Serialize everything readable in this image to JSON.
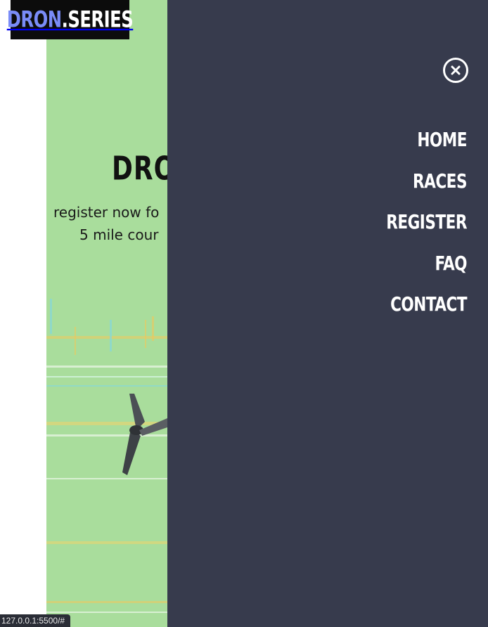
{
  "logo": {
    "part1": "DRON",
    "part2": ".SERIES"
  },
  "hero": {
    "title": "DRON",
    "subtitle_line1": "register now fo",
    "subtitle_line2": "5 mile cour"
  },
  "menu": {
    "close_icon": "close-circle-icon",
    "items": [
      {
        "label": "HOME"
      },
      {
        "label": "RACES"
      },
      {
        "label": "REGISTER"
      },
      {
        "label": "FAQ"
      },
      {
        "label": "CONTACT"
      }
    ]
  },
  "status_bar": {
    "url": "127.0.0.1:5500/#"
  },
  "colors": {
    "menu_bg": "#373b4d",
    "hero_bg": "#a9dd9c",
    "logo_accent": "#7a8cf7",
    "logo_bg": "#0c0c0c"
  }
}
